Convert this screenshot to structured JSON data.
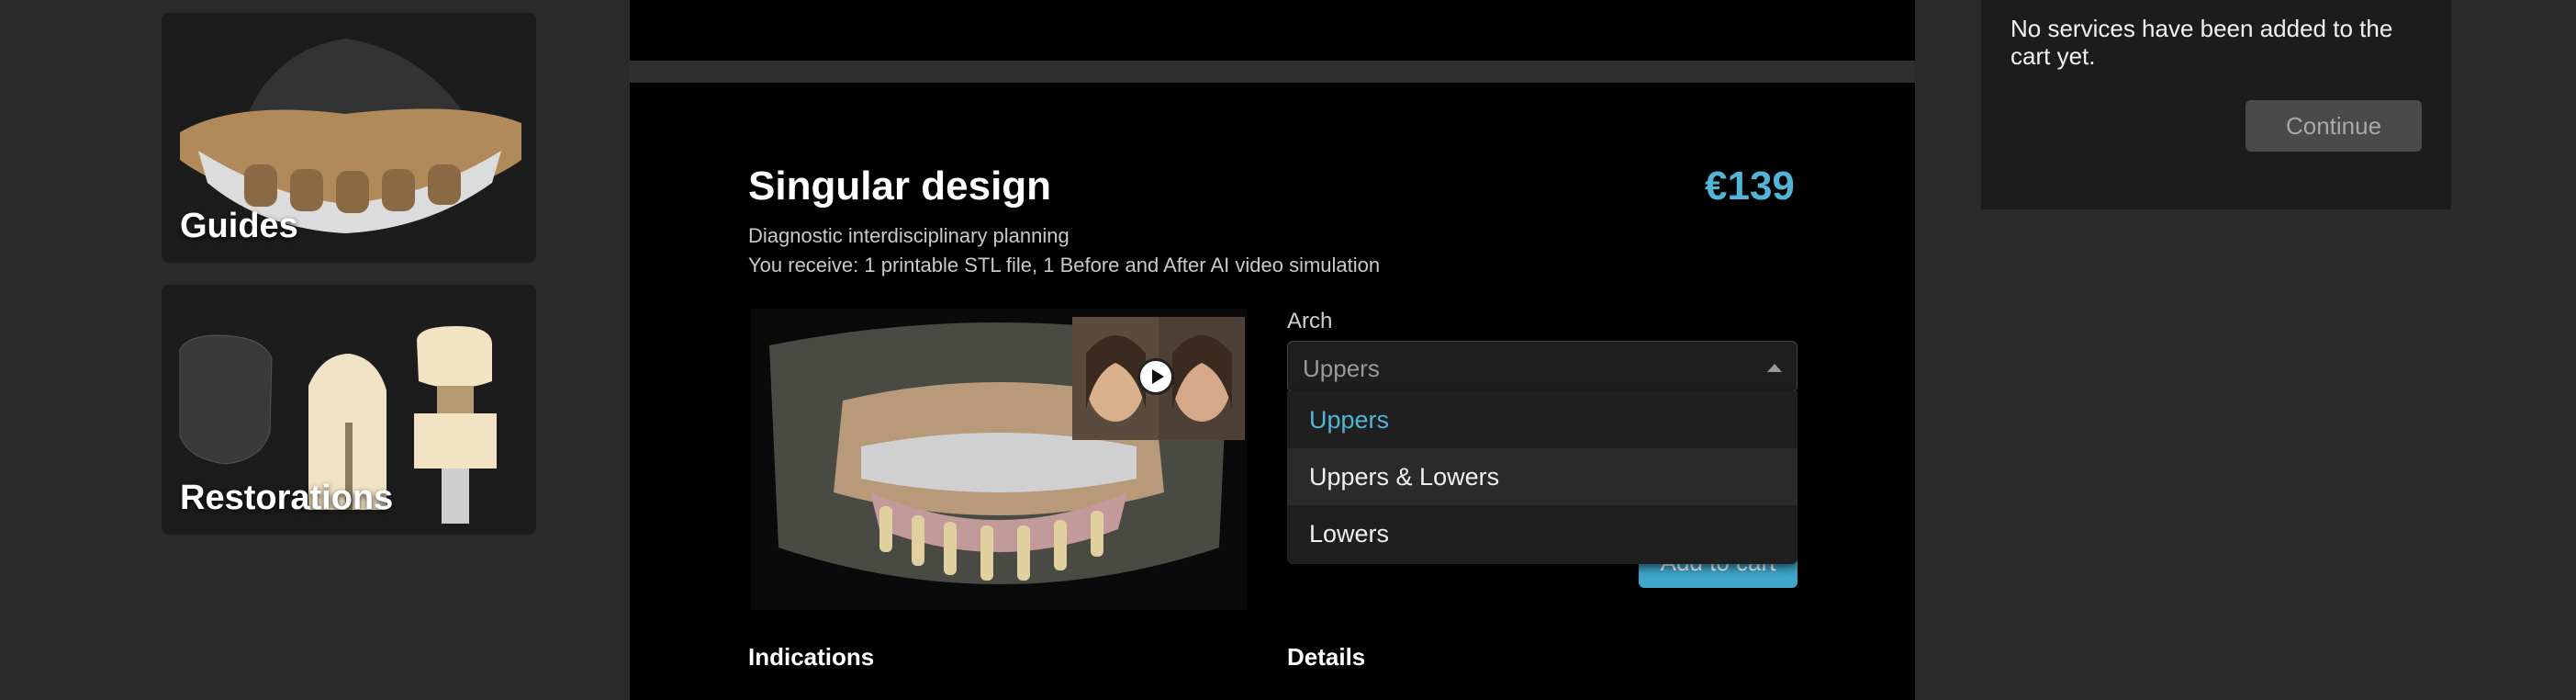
{
  "categories": [
    {
      "label": "Guides",
      "icon": "surgical-guide-image"
    },
    {
      "label": "Restorations",
      "icon": "restorations-image"
    }
  ],
  "product": {
    "title": "Singular design",
    "price": "€139",
    "subtitle_1": "Diagnostic interdisciplinary planning",
    "subtitle_2": "You receive: 1 printable STL file, 1 Before and After AI video simulation",
    "media_icon": "dental-3d-render-image",
    "video_icon": "play-icon"
  },
  "arch": {
    "label": "Arch",
    "selected": "Uppers",
    "options": [
      "Uppers",
      "Uppers & Lowers",
      "Lowers"
    ]
  },
  "add_to_cart_label": "Add to cart",
  "sections": {
    "indications": "Indications",
    "details": "Details"
  },
  "cart": {
    "empty_message": "No services have been added to the cart yet.",
    "continue_label": "Continue"
  },
  "colors": {
    "accent": "#52b5d6",
    "background": "#2b2b2b",
    "panel": "#000000"
  }
}
